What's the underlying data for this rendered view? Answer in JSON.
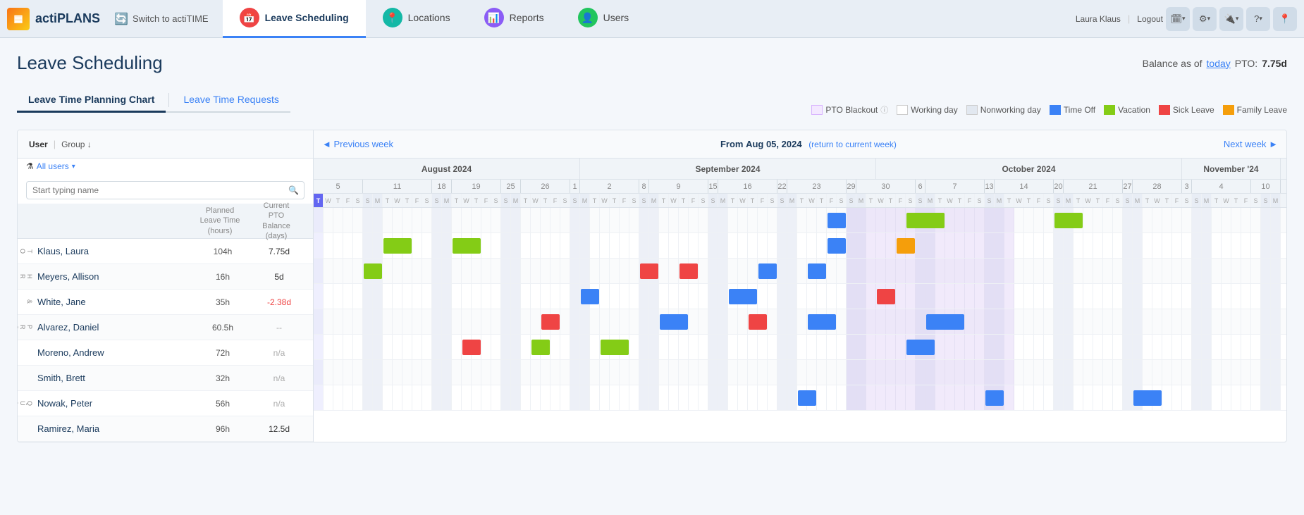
{
  "app": {
    "logo_text": "actiPLANS",
    "switch_label": "Switch to actiTIME"
  },
  "nav": {
    "items": [
      {
        "label": "Leave Scheduling",
        "icon_color": "red",
        "icon": "📅",
        "active": true
      },
      {
        "label": "Locations",
        "icon_color": "teal",
        "icon": "📍",
        "active": false
      },
      {
        "label": "Reports",
        "icon_color": "purple",
        "icon": "📊",
        "active": false
      },
      {
        "label": "Users",
        "icon_color": "green",
        "icon": "👤",
        "active": false
      }
    ],
    "user_name": "Laura Klaus",
    "logout": "Logout"
  },
  "page": {
    "title": "Leave Scheduling",
    "balance_label": "Balance as of",
    "balance_today": "today",
    "pto_label": "PTO:",
    "pto_value": "7.75d"
  },
  "tabs": [
    {
      "label": "Leave Time Planning Chart",
      "active": true
    },
    {
      "label": "Leave Time Requests",
      "active": false
    }
  ],
  "legend": [
    {
      "label": "PTO Blackout",
      "type": "pto-blackout"
    },
    {
      "label": "Working day",
      "type": "working"
    },
    {
      "label": "Nonworking day",
      "type": "nonworking"
    },
    {
      "label": "Time Off",
      "type": "timeoff"
    },
    {
      "label": "Vacation",
      "type": "vacation"
    },
    {
      "label": "Sick Leave",
      "type": "sick"
    },
    {
      "label": "Family Leave",
      "type": "family"
    }
  ],
  "chart": {
    "nav": {
      "prev": "◄ Previous week",
      "next": "Next week ►",
      "from_label": "From",
      "from_date": "Aug 05, 2024",
      "return_link": "(return to current week)"
    },
    "user_col": "User",
    "group_col": "Group",
    "planned_col": "Planned\nLeave Time\n(hours)",
    "pto_col": "Current\nPTO\nBalance\n(days)",
    "search_placeholder": "Start typing name",
    "filter_label": "All users",
    "months": [
      {
        "label": "August 2024",
        "span": 27
      },
      {
        "label": "September 2024",
        "span": 30
      },
      {
        "label": "October 2024",
        "span": 31
      },
      {
        "label": "November '24",
        "span": 8
      }
    ],
    "week_starts": [
      "5",
      "11",
      "18",
      "19",
      "25",
      "26",
      "1",
      "2",
      "8",
      "9",
      "15",
      "16",
      "22",
      "23",
      "29",
      "30",
      "6",
      "7",
      "13",
      "14",
      "20",
      "21",
      "27",
      "28",
      "3",
      "4",
      "10"
    ],
    "users": [
      {
        "name": "Klaus, Laura",
        "group": "T\nO",
        "planned": "104h",
        "pto": "7.75d",
        "pto_class": "",
        "bars": [
          {
            "type": "timeoff",
            "start": 52,
            "width": 2
          },
          {
            "type": "vacation",
            "start": 60,
            "width": 4
          },
          {
            "type": "vacation",
            "start": 75,
            "width": 3
          },
          {
            "type": "timeoff",
            "start": 120,
            "width": 4
          }
        ]
      },
      {
        "name": "Meyers, Allison",
        "group": "H\nR",
        "planned": "16h",
        "pto": "5d",
        "pto_class": "",
        "bars": [
          {
            "type": "vacation",
            "start": 7,
            "width": 3
          },
          {
            "type": "vacation",
            "start": 14,
            "width": 3
          },
          {
            "type": "timeoff",
            "start": 52,
            "width": 2
          },
          {
            "type": "family",
            "start": 59,
            "width": 2
          }
        ]
      },
      {
        "name": "White, Jane",
        "group": "&",
        "planned": "35h",
        "pto": "-2.38d",
        "pto_class": "negative",
        "bars": [
          {
            "type": "vacation",
            "start": 5,
            "width": 2
          },
          {
            "type": "sick",
            "start": 33,
            "width": 2
          },
          {
            "type": "sick",
            "start": 37,
            "width": 2
          },
          {
            "type": "timeoff",
            "start": 45,
            "width": 2
          },
          {
            "type": "timeoff",
            "start": 50,
            "width": 2
          },
          {
            "type": "hatched",
            "start": 105,
            "width": 10
          }
        ]
      },
      {
        "name": "Alvarez, Daniel",
        "group": "P\nR\nO\nD\nU\nC\nT",
        "planned": "60.5h",
        "pto": "--",
        "pto_class": "na",
        "bars": [
          {
            "type": "timeoff",
            "start": 27,
            "width": 2
          },
          {
            "type": "timeoff",
            "start": 42,
            "width": 3
          },
          {
            "type": "sick",
            "start": 57,
            "width": 2
          },
          {
            "type": "timeoff",
            "start": 112,
            "width": 2
          }
        ]
      },
      {
        "name": "Moreno, Andrew",
        "group": "",
        "planned": "72h",
        "pto": "n/a",
        "pto_class": "na",
        "bars": [
          {
            "type": "sick",
            "start": 23,
            "width": 2
          },
          {
            "type": "timeoff",
            "start": 35,
            "width": 3
          },
          {
            "type": "sick",
            "start": 44,
            "width": 2
          },
          {
            "type": "timeoff",
            "start": 50,
            "width": 3
          },
          {
            "type": "timeoff",
            "start": 62,
            "width": 4
          },
          {
            "type": "hatched-blue",
            "start": 115,
            "width": 6
          }
        ]
      },
      {
        "name": "Smith, Brett",
        "group": "",
        "planned": "32h",
        "pto": "n/a",
        "pto_class": "na",
        "bars": [
          {
            "type": "sick",
            "start": 15,
            "width": 2
          },
          {
            "type": "vacation",
            "start": 22,
            "width": 2
          },
          {
            "type": "vacation",
            "start": 29,
            "width": 3
          },
          {
            "type": "timeoff",
            "start": 60,
            "width": 3
          },
          {
            "type": "hatched",
            "start": 100,
            "width": 7
          }
        ]
      },
      {
        "name": "Nowak, Peter",
        "group": "Q\nU\nA\nL",
        "planned": "56h",
        "pto": "n/a",
        "pto_class": "na",
        "bars": [
          {
            "type": "hatched-blue",
            "start": 120,
            "width": 4
          }
        ]
      },
      {
        "name": "Ramirez, Maria",
        "group": "",
        "planned": "96h",
        "pto": "12.5d",
        "pto_class": "",
        "bars": [
          {
            "type": "timeoff",
            "start": 49,
            "width": 2
          },
          {
            "type": "timeoff",
            "start": 68,
            "width": 2
          },
          {
            "type": "timeoff",
            "start": 83,
            "width": 3
          },
          {
            "type": "family",
            "start": 110,
            "width": 2
          }
        ]
      }
    ]
  }
}
